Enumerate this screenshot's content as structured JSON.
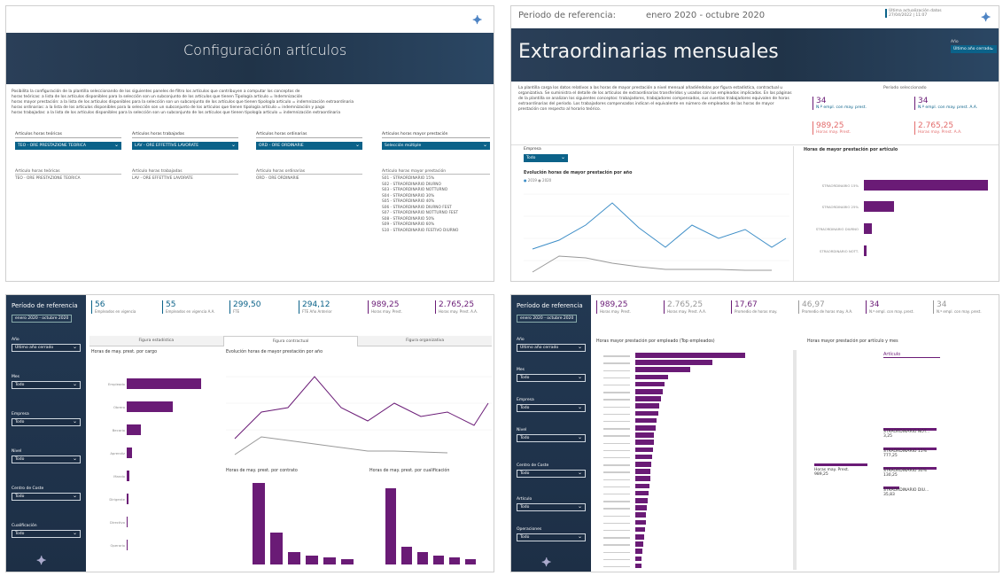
{
  "p1": {
    "title": "Configuración artículos",
    "intro": [
      "Posibilita la configuración de la plantilla seleccionando de los siguientes paneles de filtro los artículos que contribuyen a computar los conceptos de",
      "horas teóricas: a lista de los artículos disponibles para la selección son un subconjunto de los artículos que tienen Tipología artículo = Indemnización",
      "horas mayor prestación: a la lista de los artículos disponibles para la selección son un subconjunto de los artículos que tienen tipología artículo = indemnización extraordinaria",
      "horas ordinarias: a la lista de los artículos disponibles para la selección son un subconjunto de los artículos que tienen tipología artículo = indemnización y pago",
      "horas trabajadas: a la lista de los artículos disponibles para la selección son un subconjunto de los artículos que tienen tipología artículo = indemnización extraordinaria"
    ],
    "filters": [
      {
        "label": "Artículos horas teóricas",
        "value": "TEO - ORE PRESTAZIONE TEORICA"
      },
      {
        "label": "Artículos horas trabajadas",
        "value": "LAV - ORE EFFETTIVE LAVORATE"
      },
      {
        "label": "Artículos horas ordinarias",
        "value": "ORD - ORE ORDINARIE"
      },
      {
        "label": "Artículos horas mayor prestación",
        "value": "Selección múltiple"
      }
    ],
    "lists": [
      {
        "header": "Artículo horas teóricas",
        "items": [
          "TEO - ORE PRESTAZIONE TEORICA"
        ]
      },
      {
        "header": "Artículo horas trabajadas",
        "items": [
          "LAV - ORE EFFETTIVE LAVORATE"
        ]
      },
      {
        "header": "Artículo horas ordinarias",
        "items": [
          "ORD - ORE ORDINARIE"
        ]
      },
      {
        "header": "Artículo horas mayor prestación",
        "items": [
          "S01 - STRAORDINARIO 15%",
          "S02 - STRAORDINARIO DIURNO",
          "S03 - STRAORDINARIO NOTTURNO",
          "S04 - STRAORDINARIO 30%",
          "S05 - STRAORDINARIO 40%",
          "S06 - STRAORDINARIO DIURNO FEST",
          "S07 - STRAORDINARIO NOTTURNO FEST",
          "S08 - STRAORDINARIO 50%",
          "S09 - STRAORDINARIO 60%",
          "S10 - STRAORDINARIO FESTIVO DIURNO"
        ]
      }
    ]
  },
  "p2": {
    "period_label": "Periodo de referencia:",
    "period_value": "enero 2020 - octubre 2020",
    "update_label": "Última actualización datos",
    "update_value": "27/04/2022 | 11:07",
    "title": "Extraordinarias mensuales",
    "year_label": "Año",
    "year_value": "Último año cerrado",
    "intro": "La plantilla carga los datos relativos a las horas de mayor prestación a nivel mensual añadiéndolas por figura estadística, contractual u organizativa. Se suministra el detalle de los artículos de extraordinarias transferidos y usados con los empleados implicados. En las páginas de la plantilla se analizan los siguientes conceptos: trabajadores, trabajadores compensados, sus cuentas trabajadores equivalen de horas extraordinarias del período. Los trabajadores compensados indican el equivalente en número de empleados de las horas de mayor prestación con respecto al horario teórico.",
    "kpi_header": "Período seleccionado",
    "kpis": [
      {
        "value": "34",
        "label": "N.º empl. con may. prest.",
        "red": false
      },
      {
        "value": "34",
        "label": "N.º empl. con may. prest. A.A.",
        "red": false
      },
      {
        "value": "989,25",
        "label": "Horas may. Prest.",
        "red": true
      },
      {
        "value": "2.765,25",
        "label": "Horas may. Prest. A.A.",
        "red": true
      }
    ],
    "filter_label": "Empresa",
    "filter_value": "Todo",
    "line_title": "Evolución horas de mayor prestación por año",
    "legend": [
      "2019",
      "2020"
    ],
    "bar_title": "Horas de mayor prestación por artículo",
    "bar_categories": [
      "STRAORDINARIO 15%",
      "STRAORDINARIO 25%",
      "STRAORDINARIO DIURNO",
      "STRAORDINARIO NOTT."
    ],
    "bar_values": [
      977.25,
      242,
      66,
      18
    ]
  },
  "p3": {
    "period_label": "Período de referencia",
    "period_value": "enero 2020 - octubre 2020",
    "filters": [
      {
        "label": "Año",
        "value": "Último año cerrado"
      },
      {
        "label": "Mes",
        "value": "Todo"
      },
      {
        "label": "Empresa",
        "value": "Todo"
      },
      {
        "label": "Nivel",
        "value": "Todo"
      },
      {
        "label": "Centro de Coste",
        "value": "Todo"
      },
      {
        "label": "Cualificación",
        "value": "Todo"
      }
    ],
    "kpis": [
      {
        "value": "56",
        "label": "Empleados en vigencia"
      },
      {
        "value": "55",
        "label": "Empleados en vigencia A.A."
      },
      {
        "value": "299,50",
        "label": "FTE"
      },
      {
        "value": "294,12",
        "label": "FTE Año Anterior"
      },
      {
        "value": "989,25",
        "label": "Horas may. Prest."
      },
      {
        "value": "2.765,25",
        "label": "Horas may. Prest. A.A."
      }
    ],
    "tabs": [
      "Figura estadística",
      "Figura contractual",
      "Figura organizativa"
    ],
    "chart1_title": "Horas de may. prest. por cargo",
    "chart1_cats": [
      "Empleado",
      "Obrero",
      "Becario",
      "Aprendiz",
      "Mando",
      "Dirigente",
      "Directivo",
      "Operario"
    ],
    "chart1_vals": [
      600,
      370,
      110,
      40,
      20,
      12,
      8,
      4
    ],
    "chart2_title": "Evolución horas de mayor prestación por año",
    "chart3_title": "Horas de may. prest. por contrato",
    "chart4_title": "Horas de may. prest. por cualificación"
  },
  "p4": {
    "period_label": "Período de referencia",
    "period_value": "enero 2020 - octubre 2020",
    "filters": [
      {
        "label": "Año",
        "value": "Último año cerrado"
      },
      {
        "label": "Mes",
        "value": "Todo"
      },
      {
        "label": "Empresa",
        "value": "Todo"
      },
      {
        "label": "Nivel",
        "value": "Todo"
      },
      {
        "label": "Centro de Coste",
        "value": "Todo"
      },
      {
        "label": "Artículo",
        "value": "Todo"
      },
      {
        "label": "Operaciones",
        "value": "Todo"
      }
    ],
    "kpis": [
      {
        "value": "989,25",
        "label": "Horas may. Prest."
      },
      {
        "value": "2.765,25",
        "label": "Horas may. Prest. A.A."
      },
      {
        "value": "17,67",
        "label": "Promedio de horas may."
      },
      {
        "value": "46,97",
        "label": "Promedio de horas may. A.A."
      },
      {
        "value": "34",
        "label": "N.º empl. con may. prest."
      },
      {
        "value": "34",
        "label": "N.º empl. con may. prest."
      }
    ],
    "chart1_title": "Horas mayor prestación por empleado (Top empleados)",
    "chart1_vals": [
      300,
      210,
      150,
      90,
      80,
      75,
      70,
      65,
      62,
      58,
      55,
      52,
      50,
      48,
      46,
      44,
      42,
      40,
      38,
      36,
      34,
      32,
      30,
      28,
      26,
      24,
      22,
      20,
      18,
      16
    ],
    "chart2_title": "Horas mayor prestación por artículo y mes",
    "decomp_header": "Artículo",
    "decomp_root_label": "Horas may. Prest.",
    "decomp_root_value": "989,25",
    "decomp_items": [
      {
        "label": "STRAORDINARIO NOT...",
        "value": "3,25"
      },
      {
        "label": "STRAORDINARIO 15%",
        "value": "777,25"
      },
      {
        "label": "STRAORDINARIO 30%",
        "value": "130,25"
      },
      {
        "label": "STRAORDINARIO DIU...",
        "value": "35,83"
      }
    ]
  }
}
